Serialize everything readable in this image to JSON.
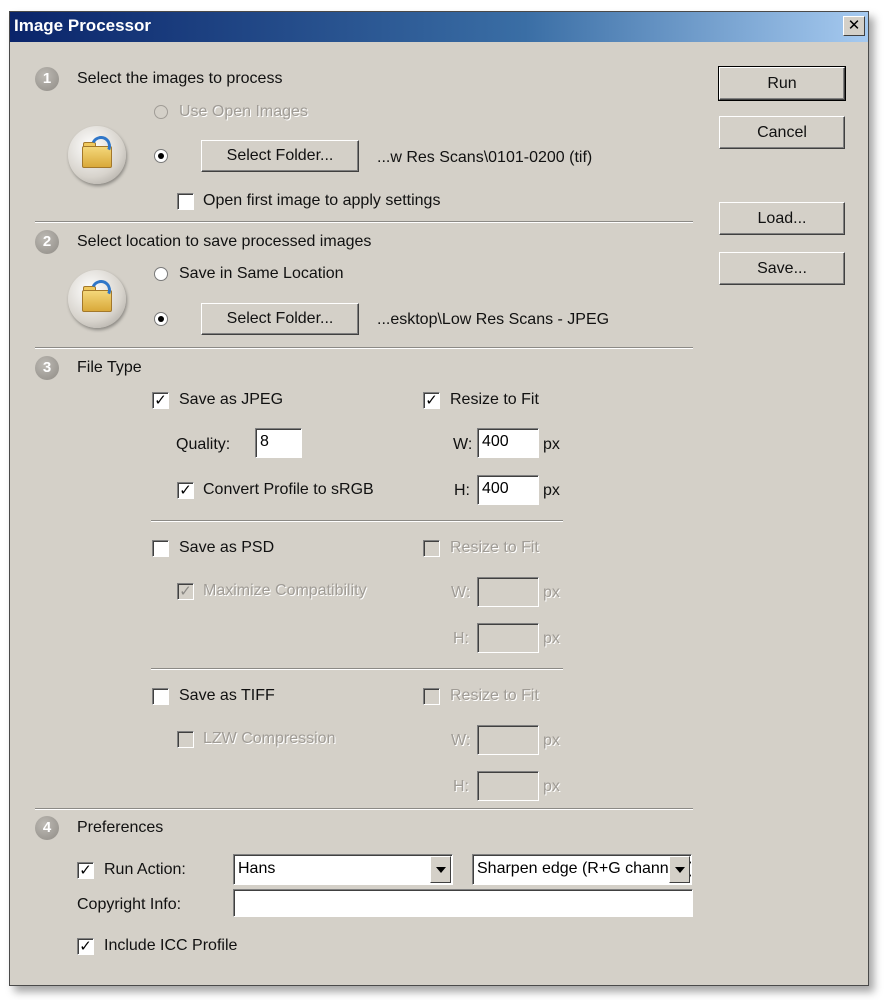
{
  "window": {
    "title": "Image Processor",
    "close_glyph": "✕"
  },
  "buttons": {
    "run": "Run",
    "cancel": "Cancel",
    "load": "Load...",
    "save": "Save..."
  },
  "section1": {
    "number": "1",
    "heading": "Select the images to process",
    "use_open_images": "Use Open Images",
    "select_folder": "Select Folder...",
    "folder_path": "...w Res Scans\\0101-0200 (tif)",
    "open_first_image": "Open first image to apply settings",
    "selected_option": "select-folder",
    "open_first_checked": false,
    "icon": "folder-icon"
  },
  "section2": {
    "number": "2",
    "heading": "Select location to save processed images",
    "save_same_location": "Save in Same Location",
    "select_folder": "Select Folder...",
    "folder_path": "...esktop\\Low Res Scans - JPEG",
    "selected_option": "select-folder",
    "icon": "folder-icon"
  },
  "section3": {
    "number": "3",
    "heading": "File Type",
    "jpeg": {
      "label": "Save as JPEG",
      "checked": true,
      "quality_label": "Quality:",
      "quality_value": "8",
      "convert_label": "Convert Profile to sRGB",
      "convert_checked": true,
      "resize_label": "Resize to Fit",
      "resize_checked": true,
      "w_label": "W:",
      "w_value": "400",
      "h_label": "H:",
      "h_value": "400",
      "unit": "px"
    },
    "psd": {
      "label": "Save as PSD",
      "checked": false,
      "maximize_label": "Maximize Compatibility",
      "maximize_checked": true,
      "resize_label": "Resize to Fit",
      "resize_checked": false,
      "w_label": "W:",
      "h_label": "H:",
      "unit": "px"
    },
    "tiff": {
      "label": "Save as TIFF",
      "checked": false,
      "lzw_label": "LZW Compression",
      "lzw_checked": false,
      "resize_label": "Resize to Fit",
      "resize_checked": false,
      "w_label": "W:",
      "h_label": "H:",
      "unit": "px"
    }
  },
  "section4": {
    "number": "4",
    "heading": "Preferences",
    "run_action_label": "Run Action:",
    "run_action_checked": true,
    "action_set": "Hans",
    "action": "Sharpen edge (R+G channels)",
    "copyright_label": "Copyright Info:",
    "copyright_value": "",
    "icc_label": "Include ICC Profile",
    "icc_checked": true
  },
  "colors": {
    "dialog_bg": "#d4d0c8",
    "title_start": "#0a246a",
    "title_end": "#a6caf0",
    "disabled_text": "#a09c96"
  }
}
